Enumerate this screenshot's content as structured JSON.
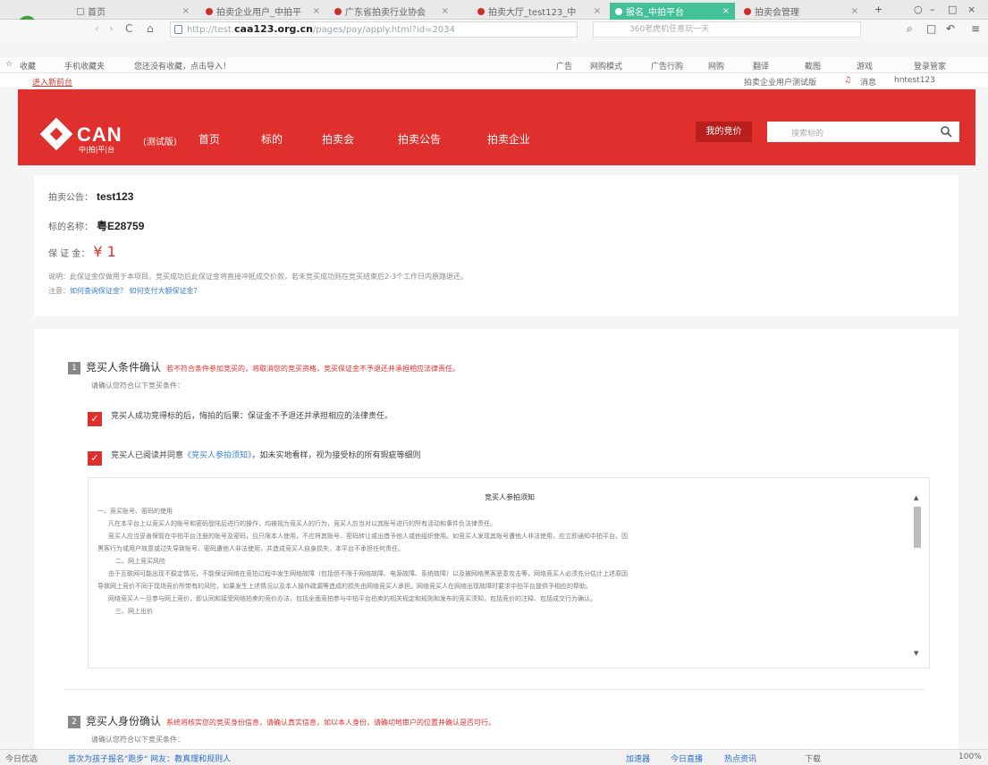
{
  "browser": {
    "tabs": [
      {
        "label": "首页",
        "active": false
      },
      {
        "label": "拍卖企业用户_中拍平",
        "active": false
      },
      {
        "label": "广东省拍卖行业协会",
        "active": false
      },
      {
        "label": "拍卖大厅_test123_中",
        "active": false
      },
      {
        "label": "报名_中拍平台",
        "active": true
      },
      {
        "label": "拍卖会管理",
        "active": false
      }
    ],
    "url_prefix": "http://test.",
    "url_host": "caa123.org.cn",
    "url_path": "/pages/pay/apply.html?id=2034",
    "search_placeholder": "360老虎机任意玩一天",
    "bookmarks": [
      "收藏",
      "手机收藏夹",
      "您还没有收藏，点击导入！",
      "广告",
      "网购模式",
      "广告行购",
      "网购",
      "翻译",
      "截图",
      "游戏",
      "登录管家"
    ]
  },
  "site_topbar": {
    "login_link": "进入新前台",
    "org_link": "拍卖企业用户测试版",
    "message": "消息",
    "user": "hntest123"
  },
  "header": {
    "logo": "CAN",
    "logo_sub": "中|拍|平|台",
    "logo_tag": "(测试版)",
    "nav": [
      "首页",
      "标的",
      "拍卖会",
      "拍卖公告",
      "拍卖企业"
    ],
    "my_bids": "我的竞价",
    "search_placeholder": "搜索标的"
  },
  "info": {
    "announcement_label": "拍卖公告：",
    "announcement_value": "test123",
    "item_label": "标的名称：",
    "item_value": "粤E28759",
    "deposit_label": "保 证 金：",
    "deposit_value": "¥ 1",
    "note1": "说明：此保证金仅做用于本项目。竞买成功后此保证金将直接冲抵成交价款，若未竞买成功则在竞买结束后2-3个工作日内原路退还。",
    "note2_prefix": "注意：",
    "note2_links": "如何查询保证金？ 如何支付大额保证金？"
  },
  "step1": {
    "num": "1",
    "title": "竞买人条件确认",
    "warning": "若不符合条件参加竞买的，将取消您的竞买资格，竞买保证金不予退还并承担相应法律责任。",
    "sub": "请确认您符合以下竞买条件：",
    "check1": "竞买人成功竞得标的后，悔拍的后果：保证金不予退还并承担相应的法律责任。",
    "check2_prefix": "竞买人已阅读并同意",
    "check2_link": "《竞买人参拍须知》",
    "check2_suffix": "，如未实地看样，视为接受标的所有瑕疵等细则",
    "terms_title": "竞买人参拍须知",
    "terms": [
      "一、竞买账号、密码的使用",
      "凡在本平台上以竞买人的账号和密码登陆后进行的操作，均被视为竞买人的行为，竞买人应当对以其账号进行的所有活动和事件负法律责任。",
      "竞买人应当妥善保管在中拍平台注册的账号及密码，且只限本人使用，不应将其账号、密码转让或出借予他人或他组织使用。如竞买人发现其账号遭他人非法使用，应立即通知中拍平台。因",
      "黑客行为或用户故意或过失导致账号、密码遭他人非法使用，并造成竞买人自身损失，本平台不承担任何责任。",
      "二、网上竞买风险",
      "由于互联网可能出现不稳定情况，不能保证网络在竞拍过程中发生网络故障（包括但不限于网络故障、电源故障、系统故障）以及被网络黑客恶意攻击等，网络竞买人必须充分估计上述原因",
      "导致网上竞价不同于现场竞价所带有的风险，如果发生上述情况以及本人操作疏漏等造成的损失由网络竞买人承担。网络竞买人在网络出现故障时要求中拍平台提供予相应的帮助。",
      "网络竞买人一旦参与网上竞价，即认同和接受网络拍卖的竞价办法，包括全面竞拍参与中拍平台拍卖的相关规定和规则和发布的竞买须知，包括竞价的注释、包括成交行为确认。",
      "三、网上出价"
    ]
  },
  "step2": {
    "num": "2",
    "title": "竞买人身份确认",
    "warning": "系统将核实您的竞买身份信息，请确认真实信息，如以本人身份，请确切地审户的位置并确认是否可行。",
    "sub": "请确认您符合以下竞买条件："
  },
  "statusbar": {
    "left": "今日优选",
    "news": "首次为孩子报名\"跑步\" 网友：教真理和规则人",
    "items": [
      "加速器",
      "今日直播",
      "热点资讯",
      "下载"
    ],
    "zoom": "100%"
  }
}
